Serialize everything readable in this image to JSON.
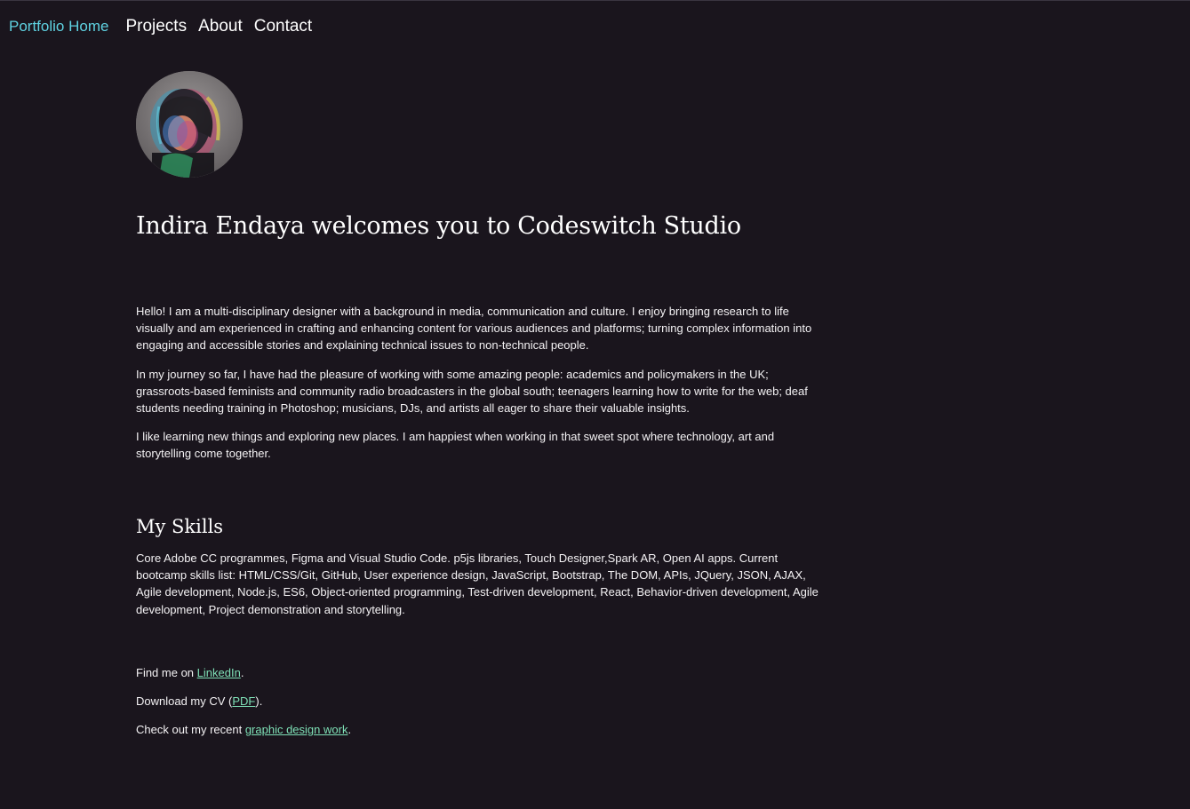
{
  "nav": {
    "home": "Portfolio Home",
    "items": [
      "Projects",
      "About",
      "Contact"
    ]
  },
  "avatar": {
    "icon": "profile-photo"
  },
  "headline": "Indira Endaya welcomes you to Codeswitch Studio",
  "intro": [
    "Hello! I am a multi-disciplinary designer with a background in media, communication and culture. I enjoy bringing research to life visually and am experienced in crafting and enhancing content for various audiences and platforms; turning complex information into engaging and accessible stories and explaining technical issues to non-technical people.",
    "In my journey so far, I have had the pleasure of working with some amazing people: academics and policymakers in the UK; grassroots-based feminists and community radio broadcasters in the global south; teenagers learning how to write for the web; deaf students needing training in Photoshop; musicians, DJs, and artists all eager to share their valuable insights.",
    "I like learning new things and exploring new places. I am happiest when working in that sweet spot where technology, art and storytelling come together."
  ],
  "skills": {
    "heading": "My Skills",
    "text": "Core Adobe CC programmes, Figma and Visual Studio Code. p5js libraries, Touch Designer,Spark AR, Open AI apps. Current bootcamp skills list: HTML/CSS/Git, GitHub, User experience design, JavaScript, Bootstrap, The DOM, APIs, JQuery, JSON, AJAX, Agile development, Node.js, ES6, Object-oriented programming, Test-driven development, React, Behavior-driven development, Agile development, Project demonstration and storytelling."
  },
  "links": {
    "linkedin": {
      "before": "Find me on ",
      "link": "LinkedIn",
      "after": "."
    },
    "cv": {
      "before": "Download my CV (",
      "link": "PDF",
      "after": ")."
    },
    "design": {
      "before": "Check out my recent ",
      "link": "graphic design work",
      "after": "."
    }
  },
  "colors": {
    "background": "#1a151d",
    "nav_home": "#5fd3e2",
    "link": "#7ee0b6"
  }
}
